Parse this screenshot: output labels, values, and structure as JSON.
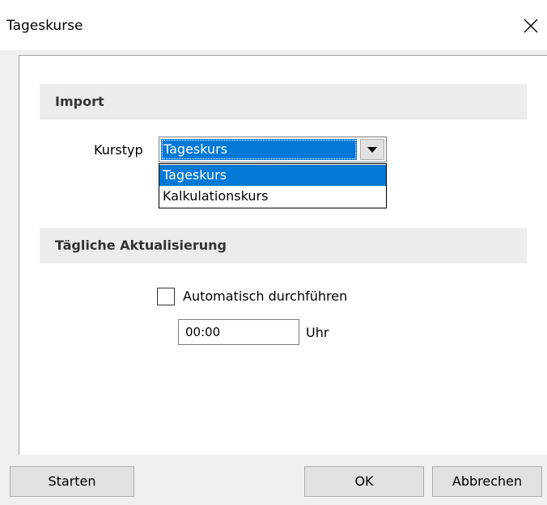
{
  "window": {
    "title": "Tageskurse",
    "close_icon": "close-icon"
  },
  "import_section": {
    "header": "Import",
    "kurstyp_label": "Kurstyp",
    "kurstyp_selected": "Tageskurs",
    "kurstyp_options": [
      "Tageskurs",
      "Kalkulationskurs"
    ],
    "dropdown_open": true
  },
  "update_section": {
    "header": "Tägliche Aktualisierung",
    "auto_label": "Automatisch durchführen",
    "auto_checked": false,
    "time_value": "00:00",
    "time_unit": "Uhr"
  },
  "buttons": {
    "start": "Starten",
    "ok": "OK",
    "cancel": "Abbrechen"
  },
  "colors": {
    "accent": "#0078d7",
    "header_bg": "#ececec",
    "button_bg": "#e1e1e1",
    "client_bg": "#f0f0f0"
  }
}
